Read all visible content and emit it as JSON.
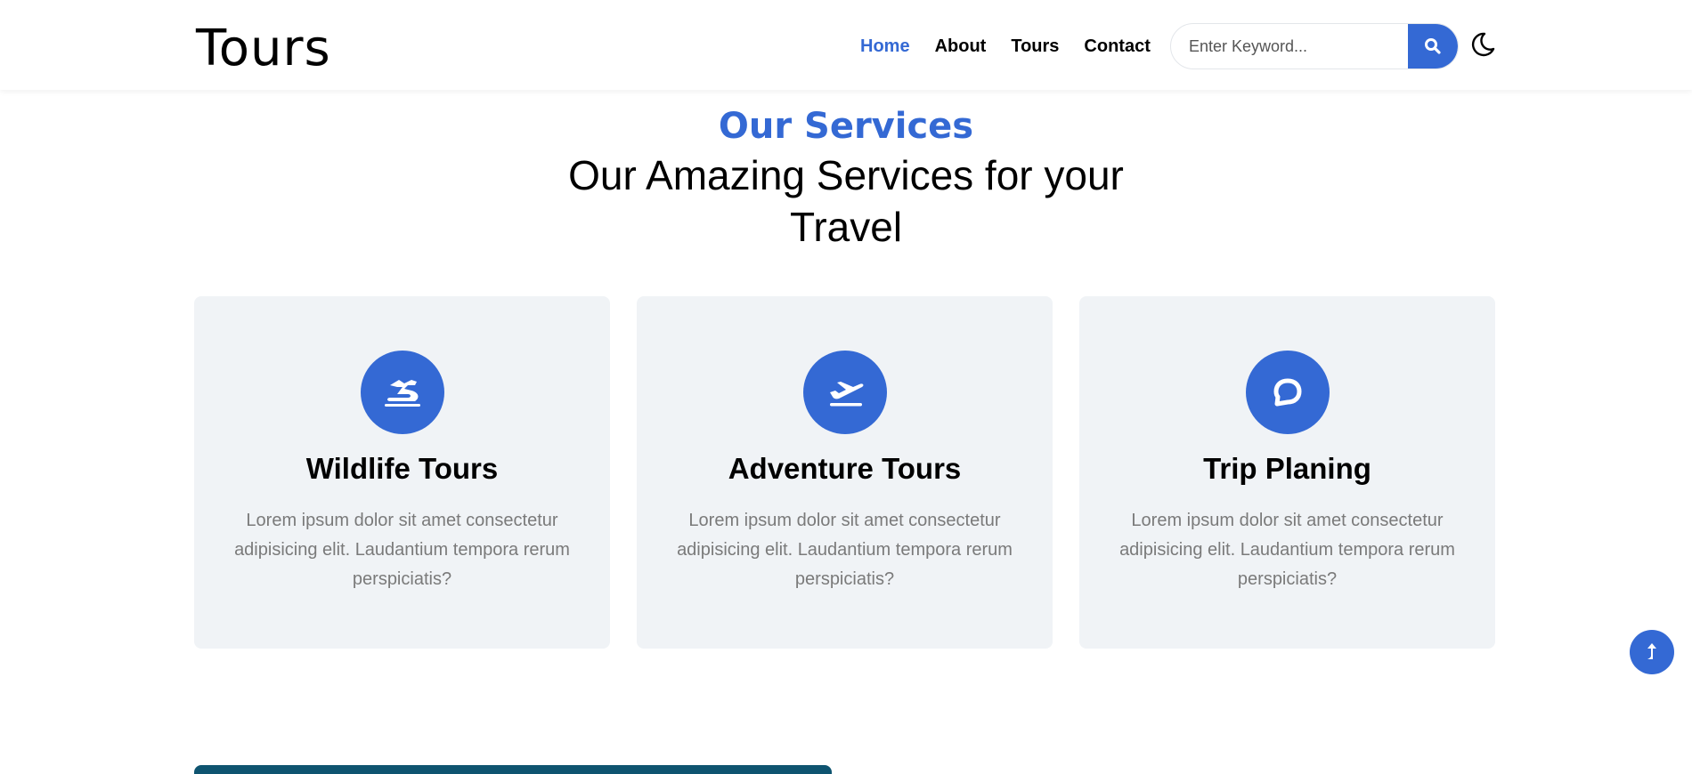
{
  "header": {
    "logo": "Tours",
    "nav": [
      {
        "label": "Home",
        "active": true
      },
      {
        "label": "About",
        "active": false
      },
      {
        "label": "Tours",
        "active": false
      },
      {
        "label": "Contact",
        "active": false
      }
    ],
    "search": {
      "placeholder": "Enter Keyword...",
      "value": ""
    },
    "search_icon": "search-icon",
    "theme_icon": "moon-icon"
  },
  "services": {
    "subtitle": "Our Services",
    "title": "Our Amazing Services for your Travel",
    "cards": [
      {
        "icon": "dragon-icon",
        "title": "Wildlife Tours",
        "text": "Lorem ipsum dolor sit amet consectetur adipisicing elit. Laudantium tempora rerum perspiciatis?"
      },
      {
        "icon": "plane-departure-icon",
        "title": "Adventure Tours",
        "text": "Lorem ipsum dolor sit amet consectetur adipisicing elit. Laudantium tempora rerum perspiciatis?"
      },
      {
        "icon": "chat-bubble-icon",
        "title": "Trip Planing",
        "text": "Lorem ipsum dolor sit amet consectetur adipisicing elit. Laudantium tempora rerum perspiciatis?"
      }
    ]
  },
  "back_to_top_icon": "arrow-up-icon",
  "colors": {
    "accent": "#3469d4",
    "card_bg": "#f0f3f6",
    "muted_text": "#7a7a7a"
  }
}
